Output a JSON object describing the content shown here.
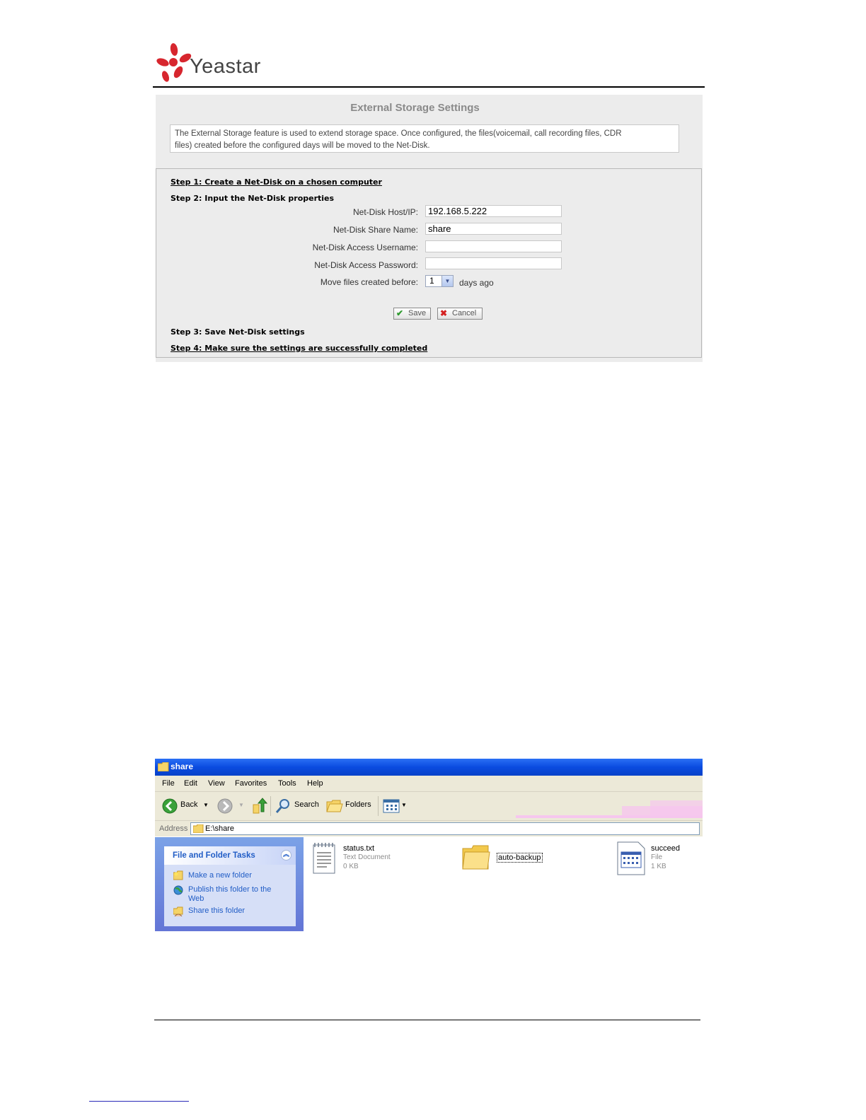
{
  "header": {
    "logo_text": "Yeastar"
  },
  "settings": {
    "title": "External Storage Settings",
    "description_line1": "The External Storage feature is used to extend storage space. Once configured, the files(voicemail, call recording files, CDR",
    "description_line2": "files) created before the configured days will be moved to the Net-Disk.",
    "step1": "Step 1: Create a Net-Disk on a chosen computer",
    "step2": "Step 2: Input the Net-Disk properties",
    "fields": {
      "host_label": "Net-Disk Host/IP:",
      "host_value": "192.168.5.222",
      "share_label": "Net-Disk Share Name:",
      "share_value": "share",
      "username_label": "Net-Disk Access Username:",
      "username_value": "",
      "password_label": "Net-Disk Access Password:",
      "password_value": "",
      "move_label": "Move files created before:",
      "move_value": "1",
      "days_suffix": "days ago"
    },
    "save_label": "Save",
    "cancel_label": "Cancel",
    "step3": "Step 3: Save Net-Disk settings",
    "step4": "Step 4: Make sure the settings are successfully completed"
  },
  "explorer": {
    "window_title": "share",
    "menu": [
      "File",
      "Edit",
      "View",
      "Favorites",
      "Tools",
      "Help"
    ],
    "toolbar": {
      "back": "Back",
      "search": "Search",
      "folders": "Folders"
    },
    "address_label": "Address",
    "address_value": "E:\\share",
    "tasks_title": "File and Folder Tasks",
    "tasks": [
      "Make a new folder",
      "Publish this folder to the",
      "Web",
      "Share this folder"
    ],
    "files": [
      {
        "name": "status.txt",
        "type": "Text Document",
        "size": "0 KB",
        "icon": "text-document-icon"
      },
      {
        "name": "auto-backup",
        "icon": "folder-icon"
      },
      {
        "name": "succeed",
        "type": "File",
        "size": "1 KB",
        "icon": "generic-file-icon"
      }
    ],
    "title_color": "#0a4be0",
    "task_link_color": "#215dc6"
  }
}
